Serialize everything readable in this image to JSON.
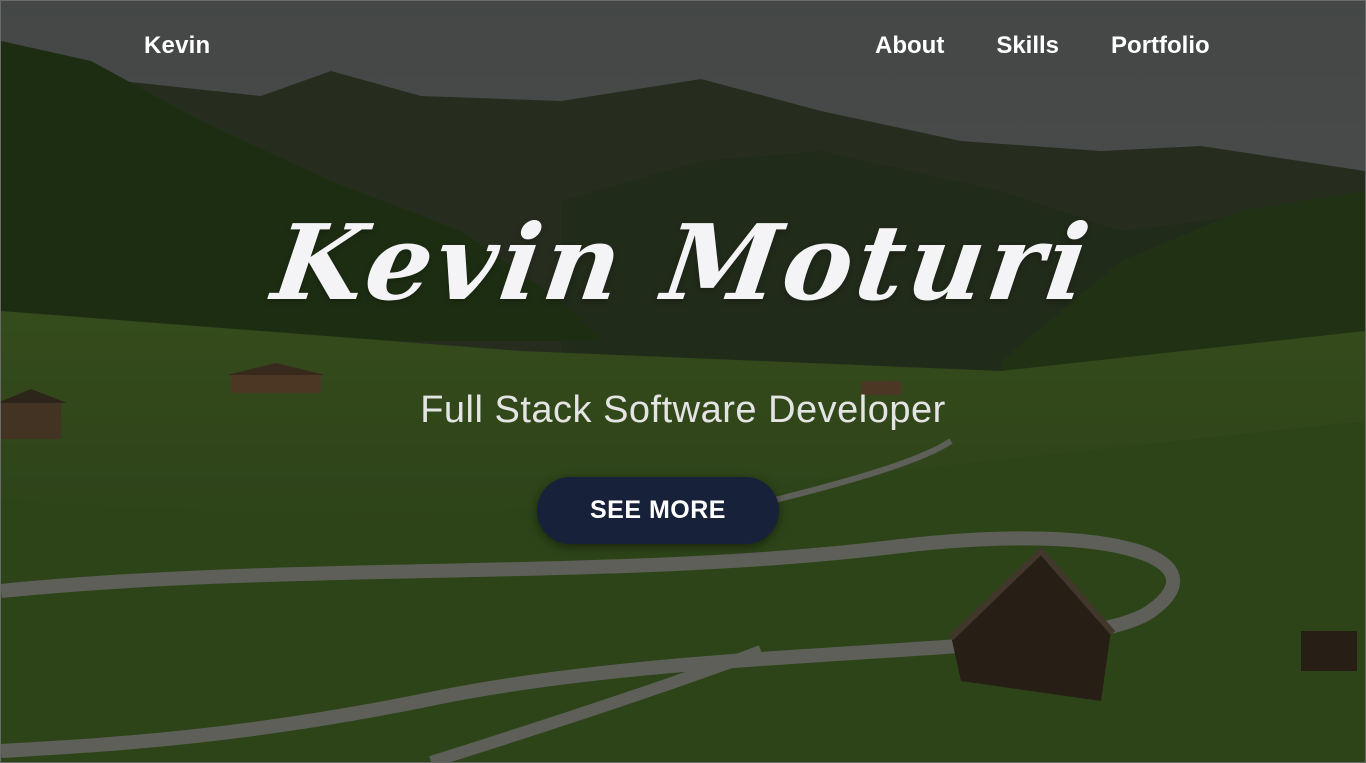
{
  "nav": {
    "brand": "Kevin",
    "links": [
      "About",
      "Skills",
      "Portfolio"
    ]
  },
  "hero": {
    "name": "Kevin Moturi",
    "subtitle": "Full Stack Software Developer",
    "cta_label": "SEE MORE",
    "background_image": "green-mountain-valley-with-winding-road-and-wooden-barns"
  },
  "colors": {
    "cta_background": "#18213a",
    "text_primary": "#ffffff"
  }
}
